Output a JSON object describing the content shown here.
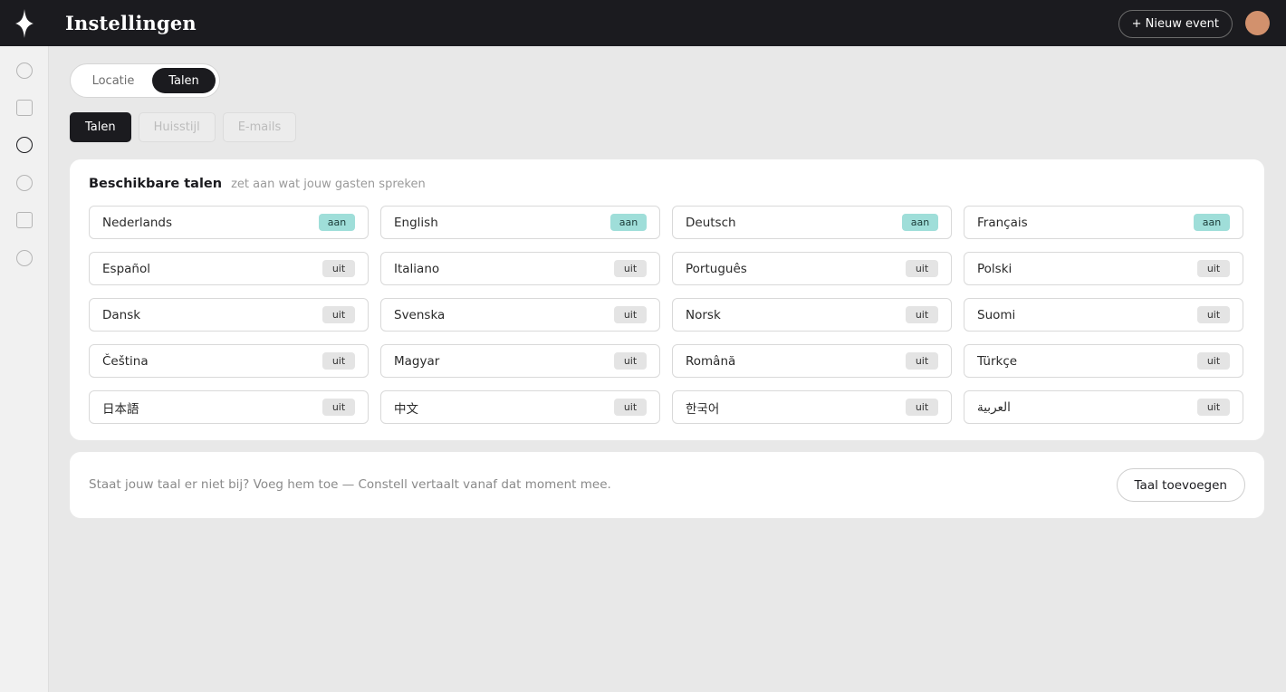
{
  "header": {
    "title": "Instellingen",
    "new_event_label": "+ Nieuw event"
  },
  "rail": {
    "items": [
      "circle-icon",
      "square-icon",
      "circle-icon",
      "circle-icon",
      "square-icon",
      "circle-icon"
    ],
    "active_index": 2
  },
  "segment": {
    "options": [
      "Locatie",
      "Talen"
    ],
    "active": "Talen"
  },
  "subtabs": {
    "items": [
      "Talen",
      "Huisstijl",
      "E-mails"
    ],
    "active": "Talen"
  },
  "languages": {
    "title": "Beschikbare talen",
    "subtitle": "zet aan wat jouw gasten spreken",
    "items": [
      {
        "name": "Nederlands",
        "status": "aan"
      },
      {
        "name": "English",
        "status": "aan"
      },
      {
        "name": "Deutsch",
        "status": "aan"
      },
      {
        "name": "Français",
        "status": "aan"
      },
      {
        "name": "Español",
        "status": "uit"
      },
      {
        "name": "Italiano",
        "status": "uit"
      },
      {
        "name": "Português",
        "status": "uit"
      },
      {
        "name": "Polski",
        "status": "uit"
      },
      {
        "name": "Dansk",
        "status": "uit"
      },
      {
        "name": "Svenska",
        "status": "uit"
      },
      {
        "name": "Norsk",
        "status": "uit"
      },
      {
        "name": "Suomi",
        "status": "uit"
      },
      {
        "name": "Čeština",
        "status": "uit"
      },
      {
        "name": "Magyar",
        "status": "uit"
      },
      {
        "name": "Română",
        "status": "uit"
      },
      {
        "name": "Türkçe",
        "status": "uit"
      },
      {
        "name": "日本語",
        "status": "uit"
      },
      {
        "name": "中文",
        "status": "uit"
      },
      {
        "name": "한국어",
        "status": "uit"
      },
      {
        "name": "العربية",
        "status": "uit"
      }
    ]
  },
  "add_language": {
    "hint": "Staat jouw taal er niet bij? Voeg hem toe — Constell vertaalt vanaf dat moment mee.",
    "button_label": "Taal toevoegen"
  },
  "colors": {
    "topbar": "#1b1b1f",
    "background": "#e8e8e8",
    "on_pill": "#9fded9",
    "off_pill": "#e4e4e4",
    "avatar": "#d2916d"
  }
}
